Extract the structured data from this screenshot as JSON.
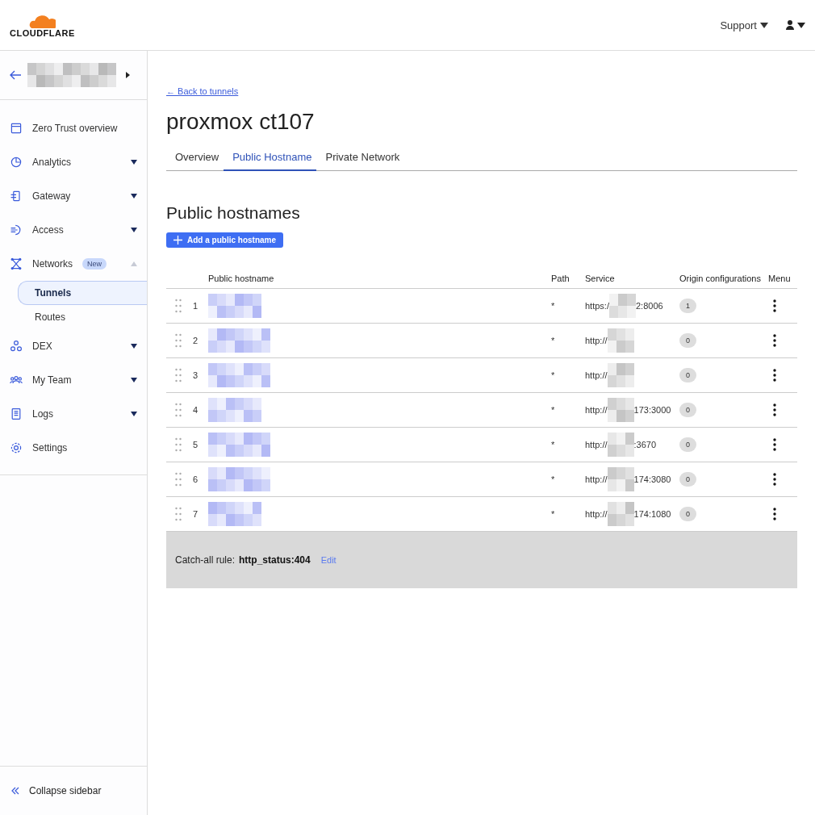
{
  "header": {
    "logo": "CLOUDFLARE",
    "support": "Support"
  },
  "sidebar": {
    "items": [
      {
        "label": "Zero Trust overview",
        "kind": "link"
      },
      {
        "label": "Analytics",
        "kind": "group",
        "expanded": false
      },
      {
        "label": "Gateway",
        "kind": "group",
        "expanded": false
      },
      {
        "label": "Access",
        "kind": "group",
        "expanded": false
      },
      {
        "label": "Networks",
        "kind": "group",
        "expanded": true,
        "badge": "New",
        "children": [
          {
            "label": "Tunnels",
            "selected": true
          },
          {
            "label": "Routes",
            "selected": false
          }
        ]
      },
      {
        "label": "DEX",
        "kind": "group",
        "expanded": false
      },
      {
        "label": "My Team",
        "kind": "group",
        "expanded": false
      },
      {
        "label": "Logs",
        "kind": "group",
        "expanded": false
      },
      {
        "label": "Settings",
        "kind": "link"
      }
    ],
    "collapse": "Collapse sidebar"
  },
  "main": {
    "back_link": "← Back to tunnels",
    "title": "proxmox ct107",
    "tabs": [
      {
        "label": "Overview",
        "selected": false
      },
      {
        "label": "Public Hostname",
        "selected": true
      },
      {
        "label": "Private Network",
        "selected": false
      }
    ],
    "section_title": "Public hostnames",
    "add_button": "Add a public hostname",
    "table": {
      "columns": [
        "Public hostname",
        "Path",
        "Service",
        "Origin configurations",
        "Menu"
      ],
      "rows": [
        {
          "number": "1",
          "path": "*",
          "service_prefix": "https:/",
          "service_suffix": "2:8006",
          "origin_count": "1"
        },
        {
          "number": "2",
          "path": "*",
          "service_prefix": "http://",
          "service_suffix": "",
          "origin_count": "0"
        },
        {
          "number": "3",
          "path": "*",
          "service_prefix": "http://",
          "service_suffix": "",
          "origin_count": "0"
        },
        {
          "number": "4",
          "path": "*",
          "service_prefix": "http://",
          "service_suffix": "173:3000",
          "origin_count": "0"
        },
        {
          "number": "5",
          "path": "*",
          "service_prefix": "http://",
          "service_suffix": ":3670",
          "origin_count": "0"
        },
        {
          "number": "6",
          "path": "*",
          "service_prefix": "http://",
          "service_suffix": "174:3080",
          "origin_count": "0"
        },
        {
          "number": "7",
          "path": "*",
          "service_prefix": "http://",
          "service_suffix": "174:1080",
          "origin_count": "0"
        }
      ]
    },
    "catch_all": {
      "label": "Catch-all rule:",
      "value": "http_status:404",
      "edit": "Edit"
    }
  }
}
